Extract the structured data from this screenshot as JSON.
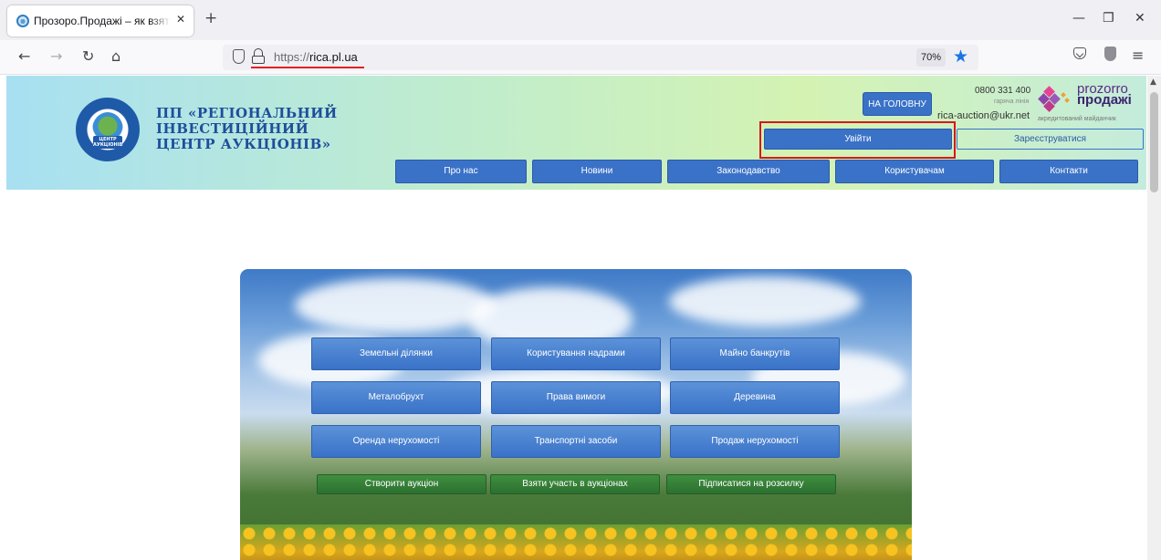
{
  "browser": {
    "tab_title": "Прозоро.Продажі – як взяти уча",
    "new_tab": "+",
    "url_scheme": "https://",
    "url_host": "rica.pl.ua",
    "zoom": "70%"
  },
  "header": {
    "logo_line1": "ПП «РЕГІОНАЛЬНИЙ",
    "logo_line2": "ІНВЕСТИЦІЙНИЙ",
    "logo_line3": "ЦЕНТР АУКЦІОНІВ»",
    "seal_text": "ЦЕНТР АУКЦІОНІВ",
    "home_button": "НА ГОЛОВНУ",
    "phone": "0800 331 400",
    "hotline": "гаряча лінія",
    "email": "rica-auction@ukr.net",
    "prozorro_word1": "prozorro",
    "prozorro_word2": "продажі",
    "prozorro_sub": "акредитований майданчик",
    "login": "Увійти",
    "register": "Зареєструватися"
  },
  "main_nav": {
    "items": [
      "Про нас",
      "Новини",
      "Законодавство",
      "Користувачам",
      "Контакти"
    ]
  },
  "hero": {
    "tiles": [
      "Земельні ділянки",
      "Користування надрами",
      "Майно банкрутів",
      "Металобрухт",
      "Права вимоги",
      "Деревина",
      "Оренда нерухомості",
      "Транспортні засоби",
      "Продаж нерухомості"
    ],
    "actions": [
      "Створити аукціон",
      "Взяти участь в аукціонах",
      "Підписатися на розсилку"
    ]
  },
  "colors": {
    "primary_blue": "#3a72c8",
    "action_green": "#2c7030",
    "highlight_red": "#d81818",
    "prozorro_purple": "#5b2a86"
  }
}
